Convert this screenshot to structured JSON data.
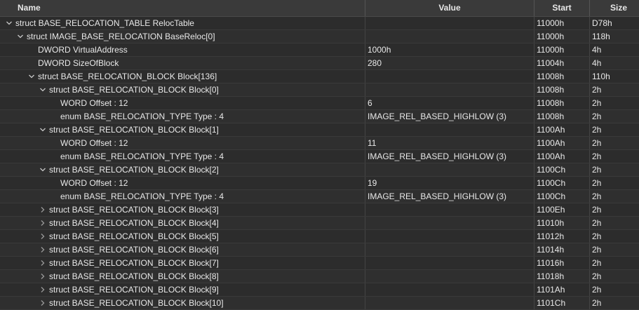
{
  "columns": {
    "name": "Name",
    "value": "Value",
    "start": "Start",
    "size": "Size"
  },
  "rows": [
    {
      "name": "struct BASE_RELOCATION_TABLE RelocTable",
      "value": "",
      "start": "11000h",
      "size": "D78h",
      "depth": 0,
      "toggle": "expanded"
    },
    {
      "name": "struct IMAGE_BASE_RELOCATION BaseReloc[0]",
      "value": "",
      "start": "11000h",
      "size": "118h",
      "depth": 1,
      "toggle": "expanded"
    },
    {
      "name": "DWORD VirtualAddress",
      "value": "1000h",
      "start": "11000h",
      "size": "4h",
      "depth": 2,
      "toggle": "none"
    },
    {
      "name": "DWORD SizeOfBlock",
      "value": "280",
      "start": "11004h",
      "size": "4h",
      "depth": 2,
      "toggle": "none"
    },
    {
      "name": "struct BASE_RELOCATION_BLOCK Block[136]",
      "value": "",
      "start": "11008h",
      "size": "110h",
      "depth": 2,
      "toggle": "expanded"
    },
    {
      "name": "struct BASE_RELOCATION_BLOCK Block[0]",
      "value": "",
      "start": "11008h",
      "size": "2h",
      "depth": 3,
      "toggle": "expanded"
    },
    {
      "name": "WORD Offset : 12",
      "value": "6",
      "start": "11008h",
      "size": "2h",
      "depth": 4,
      "toggle": "none"
    },
    {
      "name": "enum BASE_RELOCATION_TYPE Type : 4",
      "value": "IMAGE_REL_BASED_HIGHLOW (3)",
      "start": "11008h",
      "size": "2h",
      "depth": 4,
      "toggle": "none"
    },
    {
      "name": "struct BASE_RELOCATION_BLOCK Block[1]",
      "value": "",
      "start": "1100Ah",
      "size": "2h",
      "depth": 3,
      "toggle": "expanded"
    },
    {
      "name": "WORD Offset : 12",
      "value": "11",
      "start": "1100Ah",
      "size": "2h",
      "depth": 4,
      "toggle": "none"
    },
    {
      "name": "enum BASE_RELOCATION_TYPE Type : 4",
      "value": "IMAGE_REL_BASED_HIGHLOW (3)",
      "start": "1100Ah",
      "size": "2h",
      "depth": 4,
      "toggle": "none"
    },
    {
      "name": "struct BASE_RELOCATION_BLOCK Block[2]",
      "value": "",
      "start": "1100Ch",
      "size": "2h",
      "depth": 3,
      "toggle": "expanded"
    },
    {
      "name": "WORD Offset : 12",
      "value": "19",
      "start": "1100Ch",
      "size": "2h",
      "depth": 4,
      "toggle": "none"
    },
    {
      "name": "enum BASE_RELOCATION_TYPE Type : 4",
      "value": "IMAGE_REL_BASED_HIGHLOW (3)",
      "start": "1100Ch",
      "size": "2h",
      "depth": 4,
      "toggle": "none"
    },
    {
      "name": "struct BASE_RELOCATION_BLOCK Block[3]",
      "value": "",
      "start": "1100Eh",
      "size": "2h",
      "depth": 3,
      "toggle": "collapsed"
    },
    {
      "name": "struct BASE_RELOCATION_BLOCK Block[4]",
      "value": "",
      "start": "11010h",
      "size": "2h",
      "depth": 3,
      "toggle": "collapsed"
    },
    {
      "name": "struct BASE_RELOCATION_BLOCK Block[5]",
      "value": "",
      "start": "11012h",
      "size": "2h",
      "depth": 3,
      "toggle": "collapsed"
    },
    {
      "name": "struct BASE_RELOCATION_BLOCK Block[6]",
      "value": "",
      "start": "11014h",
      "size": "2h",
      "depth": 3,
      "toggle": "collapsed"
    },
    {
      "name": "struct BASE_RELOCATION_BLOCK Block[7]",
      "value": "",
      "start": "11016h",
      "size": "2h",
      "depth": 3,
      "toggle": "collapsed"
    },
    {
      "name": "struct BASE_RELOCATION_BLOCK Block[8]",
      "value": "",
      "start": "11018h",
      "size": "2h",
      "depth": 3,
      "toggle": "collapsed"
    },
    {
      "name": "struct BASE_RELOCATION_BLOCK Block[9]",
      "value": "",
      "start": "1101Ah",
      "size": "2h",
      "depth": 3,
      "toggle": "collapsed"
    },
    {
      "name": "struct BASE_RELOCATION_BLOCK Block[10]",
      "value": "",
      "start": "1101Ch",
      "size": "2h",
      "depth": 3,
      "toggle": "collapsed"
    }
  ]
}
